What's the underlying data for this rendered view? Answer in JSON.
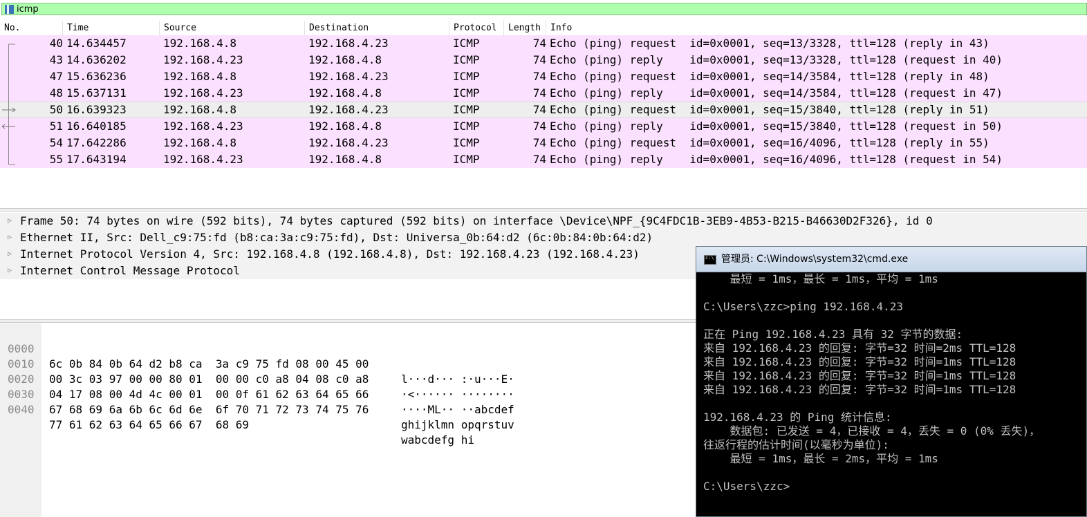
{
  "filter": {
    "value": "icmp"
  },
  "packet_list": {
    "columns": [
      "No.",
      "Time",
      "Source",
      "Destination",
      "Protocol",
      "Length",
      "Info"
    ],
    "rows": [
      {
        "no": "40",
        "time": "14.634457",
        "src": "192.168.4.8",
        "dst": "192.168.4.23",
        "proto": "ICMP",
        "len": "74",
        "info": "Echo (ping) request  id=0x0001, seq=13/3328, ttl=128 (reply in 43)"
      },
      {
        "no": "43",
        "time": "14.636202",
        "src": "192.168.4.23",
        "dst": "192.168.4.8",
        "proto": "ICMP",
        "len": "74",
        "info": "Echo (ping) reply    id=0x0001, seq=13/3328, ttl=128 (request in 40)"
      },
      {
        "no": "47",
        "time": "15.636236",
        "src": "192.168.4.8",
        "dst": "192.168.4.23",
        "proto": "ICMP",
        "len": "74",
        "info": "Echo (ping) request  id=0x0001, seq=14/3584, ttl=128 (reply in 48)"
      },
      {
        "no": "48",
        "time": "15.637131",
        "src": "192.168.4.23",
        "dst": "192.168.4.8",
        "proto": "ICMP",
        "len": "74",
        "info": "Echo (ping) reply    id=0x0001, seq=14/3584, ttl=128 (request in 47)"
      },
      {
        "no": "50",
        "time": "16.639323",
        "src": "192.168.4.8",
        "dst": "192.168.4.23",
        "proto": "ICMP",
        "len": "74",
        "info": "Echo (ping) request  id=0x0001, seq=15/3840, ttl=128 (reply in 51)"
      },
      {
        "no": "51",
        "time": "16.640185",
        "src": "192.168.4.23",
        "dst": "192.168.4.8",
        "proto": "ICMP",
        "len": "74",
        "info": "Echo (ping) reply    id=0x0001, seq=15/3840, ttl=128 (request in 50)"
      },
      {
        "no": "54",
        "time": "17.642286",
        "src": "192.168.4.8",
        "dst": "192.168.4.23",
        "proto": "ICMP",
        "len": "74",
        "info": "Echo (ping) request  id=0x0001, seq=16/4096, ttl=128 (reply in 55)"
      },
      {
        "no": "55",
        "time": "17.643194",
        "src": "192.168.4.23",
        "dst": "192.168.4.8",
        "proto": "ICMP",
        "len": "74",
        "info": "Echo (ping) reply    id=0x0001, seq=16/4096, ttl=128 (request in 54)"
      }
    ],
    "selected_no": "50",
    "row_color": "#fce0ff"
  },
  "details": [
    "Frame 50: 74 bytes on wire (592 bits), 74 bytes captured (592 bits) on interface \\Device\\NPF_{9C4FDC1B-3EB9-4B53-B215-B46630D2F326}, id 0",
    "Ethernet II, Src: Dell_c9:75:fd (b8:ca:3a:c9:75:fd), Dst: Universa_0b:64:d2 (6c:0b:84:0b:64:d2)",
    "Internet Protocol Version 4, Src: 192.168.4.8 (192.168.4.8), Dst: 192.168.4.23 (192.168.4.23)",
    "Internet Control Message Protocol"
  ],
  "bytes": [
    {
      "offset": "0000",
      "hex": "6c 0b 84 0b 64 d2 b8 ca  3a c9 75 fd 08 00 45 00",
      "ascii": "l···d··· :·u···E·"
    },
    {
      "offset": "0010",
      "hex": "00 3c 03 97 00 00 80 01  00 00 c0 a8 04 08 c0 a8",
      "ascii": "·<······ ········"
    },
    {
      "offset": "0020",
      "hex": "04 17 08 00 4d 4c 00 01  00 0f 61 62 63 64 65 66",
      "ascii": "····ML·· ··abcdef"
    },
    {
      "offset": "0030",
      "hex": "67 68 69 6a 6b 6c 6d 6e  6f 70 71 72 73 74 75 76",
      "ascii": "ghijklmn opqrstuv"
    },
    {
      "offset": "0040",
      "hex": "77 61 62 63 64 65 66 67  68 69",
      "ascii": "wabcdefg hi"
    }
  ],
  "cmd": {
    "title": "管理员: C:\\Windows\\system32\\cmd.exe",
    "lines": [
      "    最短 = 1ms，最长 = 1ms，平均 = 1ms",
      "",
      "C:\\Users\\zzc>ping 192.168.4.23",
      "",
      "正在 Ping 192.168.4.23 具有 32 字节的数据:",
      "来自 192.168.4.23 的回复: 字节=32 时间=2ms TTL=128",
      "来自 192.168.4.23 的回复: 字节=32 时间=1ms TTL=128",
      "来自 192.168.4.23 的回复: 字节=32 时间=1ms TTL=128",
      "来自 192.168.4.23 的回复: 字节=32 时间=1ms TTL=128",
      "",
      "192.168.4.23 的 Ping 统计信息:",
      "    数据包: 已发送 = 4，已接收 = 4，丢失 = 0 (0% 丢失)，",
      "往返行程的估计时间(以毫秒为单位):",
      "    最短 = 1ms，最长 = 2ms，平均 = 1ms",
      "",
      "C:\\Users\\zzc>"
    ]
  }
}
